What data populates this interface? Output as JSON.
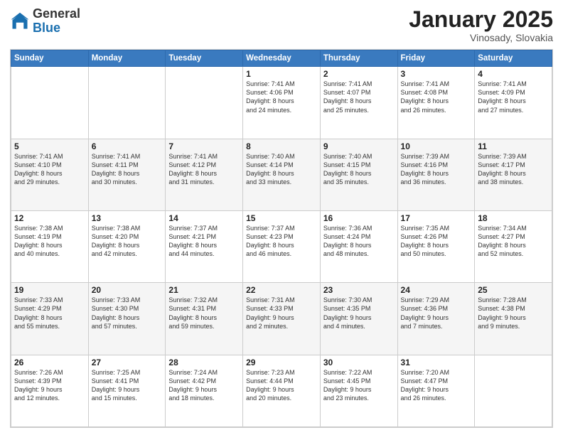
{
  "header": {
    "logo_general": "General",
    "logo_blue": "Blue",
    "month_title": "January 2025",
    "location": "Vinosady, Slovakia"
  },
  "weekdays": [
    "Sunday",
    "Monday",
    "Tuesday",
    "Wednesday",
    "Thursday",
    "Friday",
    "Saturday"
  ],
  "weeks": [
    [
      {
        "day": "",
        "info": ""
      },
      {
        "day": "",
        "info": ""
      },
      {
        "day": "",
        "info": ""
      },
      {
        "day": "1",
        "info": "Sunrise: 7:41 AM\nSunset: 4:06 PM\nDaylight: 8 hours\nand 24 minutes."
      },
      {
        "day": "2",
        "info": "Sunrise: 7:41 AM\nSunset: 4:07 PM\nDaylight: 8 hours\nand 25 minutes."
      },
      {
        "day": "3",
        "info": "Sunrise: 7:41 AM\nSunset: 4:08 PM\nDaylight: 8 hours\nand 26 minutes."
      },
      {
        "day": "4",
        "info": "Sunrise: 7:41 AM\nSunset: 4:09 PM\nDaylight: 8 hours\nand 27 minutes."
      }
    ],
    [
      {
        "day": "5",
        "info": "Sunrise: 7:41 AM\nSunset: 4:10 PM\nDaylight: 8 hours\nand 29 minutes."
      },
      {
        "day": "6",
        "info": "Sunrise: 7:41 AM\nSunset: 4:11 PM\nDaylight: 8 hours\nand 30 minutes."
      },
      {
        "day": "7",
        "info": "Sunrise: 7:41 AM\nSunset: 4:12 PM\nDaylight: 8 hours\nand 31 minutes."
      },
      {
        "day": "8",
        "info": "Sunrise: 7:40 AM\nSunset: 4:14 PM\nDaylight: 8 hours\nand 33 minutes."
      },
      {
        "day": "9",
        "info": "Sunrise: 7:40 AM\nSunset: 4:15 PM\nDaylight: 8 hours\nand 35 minutes."
      },
      {
        "day": "10",
        "info": "Sunrise: 7:39 AM\nSunset: 4:16 PM\nDaylight: 8 hours\nand 36 minutes."
      },
      {
        "day": "11",
        "info": "Sunrise: 7:39 AM\nSunset: 4:17 PM\nDaylight: 8 hours\nand 38 minutes."
      }
    ],
    [
      {
        "day": "12",
        "info": "Sunrise: 7:38 AM\nSunset: 4:19 PM\nDaylight: 8 hours\nand 40 minutes."
      },
      {
        "day": "13",
        "info": "Sunrise: 7:38 AM\nSunset: 4:20 PM\nDaylight: 8 hours\nand 42 minutes."
      },
      {
        "day": "14",
        "info": "Sunrise: 7:37 AM\nSunset: 4:21 PM\nDaylight: 8 hours\nand 44 minutes."
      },
      {
        "day": "15",
        "info": "Sunrise: 7:37 AM\nSunset: 4:23 PM\nDaylight: 8 hours\nand 46 minutes."
      },
      {
        "day": "16",
        "info": "Sunrise: 7:36 AM\nSunset: 4:24 PM\nDaylight: 8 hours\nand 48 minutes."
      },
      {
        "day": "17",
        "info": "Sunrise: 7:35 AM\nSunset: 4:26 PM\nDaylight: 8 hours\nand 50 minutes."
      },
      {
        "day": "18",
        "info": "Sunrise: 7:34 AM\nSunset: 4:27 PM\nDaylight: 8 hours\nand 52 minutes."
      }
    ],
    [
      {
        "day": "19",
        "info": "Sunrise: 7:33 AM\nSunset: 4:29 PM\nDaylight: 8 hours\nand 55 minutes."
      },
      {
        "day": "20",
        "info": "Sunrise: 7:33 AM\nSunset: 4:30 PM\nDaylight: 8 hours\nand 57 minutes."
      },
      {
        "day": "21",
        "info": "Sunrise: 7:32 AM\nSunset: 4:31 PM\nDaylight: 8 hours\nand 59 minutes."
      },
      {
        "day": "22",
        "info": "Sunrise: 7:31 AM\nSunset: 4:33 PM\nDaylight: 9 hours\nand 2 minutes."
      },
      {
        "day": "23",
        "info": "Sunrise: 7:30 AM\nSunset: 4:35 PM\nDaylight: 9 hours\nand 4 minutes."
      },
      {
        "day": "24",
        "info": "Sunrise: 7:29 AM\nSunset: 4:36 PM\nDaylight: 9 hours\nand 7 minutes."
      },
      {
        "day": "25",
        "info": "Sunrise: 7:28 AM\nSunset: 4:38 PM\nDaylight: 9 hours\nand 9 minutes."
      }
    ],
    [
      {
        "day": "26",
        "info": "Sunrise: 7:26 AM\nSunset: 4:39 PM\nDaylight: 9 hours\nand 12 minutes."
      },
      {
        "day": "27",
        "info": "Sunrise: 7:25 AM\nSunset: 4:41 PM\nDaylight: 9 hours\nand 15 minutes."
      },
      {
        "day": "28",
        "info": "Sunrise: 7:24 AM\nSunset: 4:42 PM\nDaylight: 9 hours\nand 18 minutes."
      },
      {
        "day": "29",
        "info": "Sunrise: 7:23 AM\nSunset: 4:44 PM\nDaylight: 9 hours\nand 20 minutes."
      },
      {
        "day": "30",
        "info": "Sunrise: 7:22 AM\nSunset: 4:45 PM\nDaylight: 9 hours\nand 23 minutes."
      },
      {
        "day": "31",
        "info": "Sunrise: 7:20 AM\nSunset: 4:47 PM\nDaylight: 9 hours\nand 26 minutes."
      },
      {
        "day": "",
        "info": ""
      }
    ]
  ]
}
